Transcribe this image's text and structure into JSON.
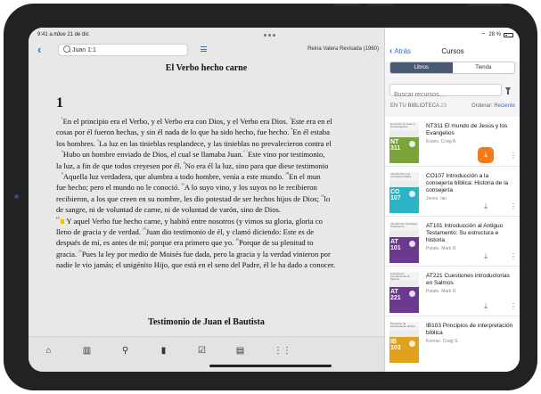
{
  "status": {
    "time": "9:41 a.m.",
    "date": "Jue 21 de dic",
    "battery": "28 %"
  },
  "reader": {
    "search_value": "Juan 1:1",
    "version": "Reina Valera Revisada (1960)",
    "heading1": "El Verbo hecho carne",
    "chapter": "1",
    "lines": [
      [
        "¹",
        "En el principio era el Verbo, y el Verbo era con Dios, y el Verbo era Dios. ",
        "²",
        "Este era en el"
      ],
      [
        "",
        "cosas por él fueron hechas, y sin él nada de lo que ha sido hecho, fue hecho. ",
        "⁴",
        "En él estaba"
      ],
      [
        "",
        "los hombres. ",
        "⁵",
        "La luz en las tinieblas resplandece, y las tinieblas no prevalecieron contra el"
      ],
      [
        "⁶",
        "Hubo un hombre enviado de Dios, el cual se llamaba Juan.",
        "⁴ ⁷",
        "Este vino por testimonio,"
      ],
      [
        "",
        "la luz, a fin de que todos creyesen por él. ",
        "⁸",
        "No era él la luz, sino para que diese testimonio"
      ],
      [
        "⁹",
        "Aquella luz verdadera, que alumbra a todo hombre, venía a este mundo. ",
        "¹⁰",
        "En el mun"
      ],
      [
        "",
        "fue hecho; pero el mundo no le conoció. ",
        "¹¹",
        "A lo suyo vino, y los suyos no le recibieron"
      ],
      [
        "",
        "recibieron, a los que creen en su nombre, les dio potestad de ser hechos hijos de Dios; ",
        "¹³",
        "lo"
      ],
      [
        "",
        "de sangre, ni de voluntad de carne, ni de voluntad de varón, sino de Dios.",
        "",
        ""
      ],
      [
        "¹⁴",
        " Y aquel Verbo fue hecho carne, y habitó entre nosotros (y vimos su gloria, gloria co",
        "",
        ""
      ],
      [
        "",
        "lleno de gracia y de verdad. ",
        "¹⁵",
        "Juan dio testimonio de él, y clamó diciendo: Este es de"
      ],
      [
        "",
        "después de mí, es antes de mí; porque era primero que yo. ",
        "¹⁶",
        "Porque de su plenitud to"
      ],
      [
        "",
        "gracia. ",
        "¹⁷",
        "Pues la ley por medio de Moisés fue dada, pero la gracia y la verdad vinieron por"
      ],
      [
        "",
        "nadie le vio jamás; el unigénito Hijo, que está en el seno del Padre, él le ha dado a conocer.",
        "",
        ""
      ]
    ],
    "heading2": "Testimonio de Juan el Bautista"
  },
  "tabbar": {
    "icons": [
      "home-icon",
      "library-icon",
      "search-icon",
      "bookmark-plus-icon",
      "checklist-icon",
      "document-icon",
      "apps-grid-icon"
    ]
  },
  "panel": {
    "back_label": "Atrás",
    "title": "Cursos",
    "seg_active": "Libros",
    "seg_inactive": "Tienda",
    "search_placeholder": "Buscar recursos...",
    "library_label": "EN TU BIBLIOTECA",
    "library_count": "23",
    "order_label": "Ordenar:",
    "order_value": "Reciente",
    "courses": [
      {
        "code": "NT 311",
        "cover_title": "El mundo de Jesús y los Evangelios",
        "title": "NT311 El mundo de Jesús y los Evangelios",
        "author": "Evans, Craig A.",
        "color": "#7aa33a",
        "downloading": true
      },
      {
        "code": "CO 107",
        "cover_title": "Introducción a la consejería bíblica",
        "title": "CO107 Introducción a la consejería bíblica: Historia de la consejería",
        "author": "Jones, Ian",
        "color": "#2bb5c4",
        "downloading": false
      },
      {
        "code": "AT 101",
        "cover_title": "Introducción al Antiguo Testamento",
        "title": "AT101 Introducción al Antiguo Testamento: Su estructura e historia",
        "author": "Putato, Mark D.",
        "color": "#6b3a8f",
        "downloading": false
      },
      {
        "code": "AT 221",
        "cover_title": "Cuestiones introductorias en Salmos",
        "title": "AT221 Cuestiones introductorias en Salmos",
        "author": "Putato, Mark D.",
        "color": "#6b3a8f",
        "downloading": false
      },
      {
        "code": "IB 103",
        "cover_title": "Principios de interpretación bíblica",
        "title": "IB103 Principios de interpretación bíblica",
        "author": "Keener, Craig S.",
        "color": "#e0a21a",
        "downloading": false
      }
    ]
  },
  "colors": {
    "accent": "#2f6fd8",
    "download_highlight": "#f07b1d",
    "segment_active": "#4b5a73"
  }
}
